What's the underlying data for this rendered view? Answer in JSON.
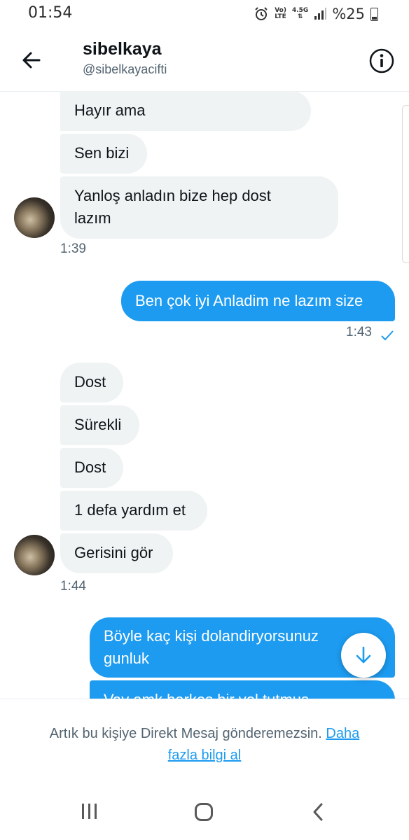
{
  "status_bar": {
    "time": "01:54",
    "network_top": "Vo)",
    "network_bottom": "LTE",
    "speed": "4.5G",
    "battery": "%25"
  },
  "header": {
    "name": "sibelkaya",
    "handle": "@sibelkayacifti"
  },
  "messages": {
    "m1": "Hayır ama",
    "m2": "Sen bizi",
    "m3_line1": "Yanloş anladın bize hep dost",
    "m3_line2": "lazım",
    "t1": "1:39",
    "m4": "Ben çok iyi Anladim ne lazım size",
    "t2": "1:43",
    "m5": "Dost",
    "m6": "Sürekli",
    "m7": "Dost",
    "m8": "1 defa yardım et",
    "m9": "Gerisini gör",
    "t3": "1:44",
    "m10_line1": "Böyle kaç kişi dolandiryorsunuz",
    "m10_line2": "gunluk",
    "m11_partial": "Vay amk herkes bir yol tutmus"
  },
  "footer": {
    "notice": "Artık bu kişiye Direkt Mesaj gönderemezsin.",
    "link_line1": "Daha",
    "link_line2": "fazla bilgi al"
  },
  "colors": {
    "accent": "#1d9bf0",
    "incoming_bubble": "#eff3f4",
    "text_secondary": "#536471"
  },
  "icons": [
    "back-arrow-icon",
    "info-icon",
    "checkmark-icon",
    "arrow-down-icon",
    "recent-apps-icon",
    "home-icon",
    "nav-back-icon"
  ]
}
